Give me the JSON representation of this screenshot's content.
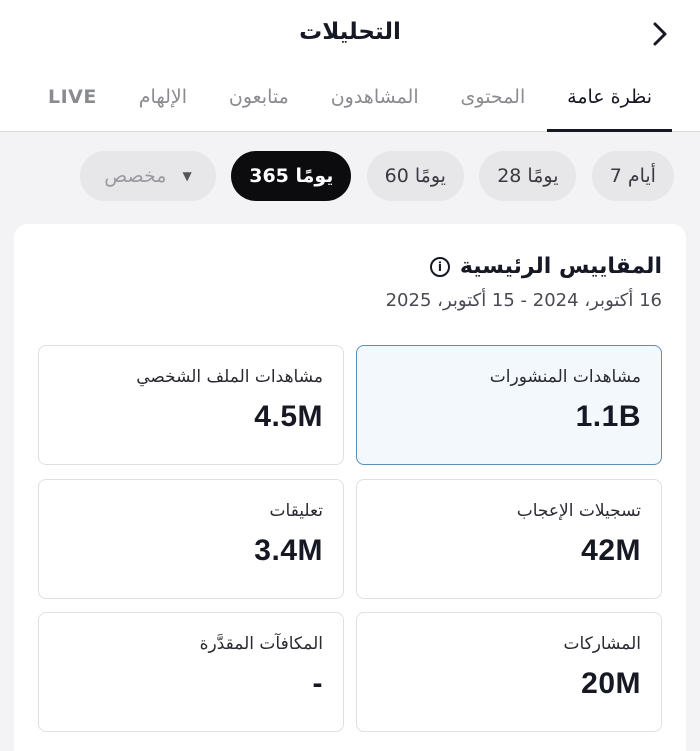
{
  "header": {
    "title": "التحليلات"
  },
  "tabs": [
    {
      "label": "نظرة عامة",
      "active": true
    },
    {
      "label": "المحتوى",
      "active": false
    },
    {
      "label": "المشاهدون",
      "active": false
    },
    {
      "label": "متابعون",
      "active": false
    },
    {
      "label": "الإلهام",
      "active": false
    },
    {
      "label": "LIVE",
      "active": false
    }
  ],
  "date_chips": [
    {
      "label": "7 أيام",
      "active": false
    },
    {
      "label": "28 يومًا",
      "active": false
    },
    {
      "label": "60 يومًا",
      "active": false
    },
    {
      "label": "365 يومًا",
      "active": true
    },
    {
      "label": "مخصص",
      "active": false
    }
  ],
  "metrics_panel": {
    "title": "المقاييس الرئيسية",
    "date_range": "16 أكتوبر، 2024 - 15 أكتوبر، 2025",
    "cards": [
      {
        "label": "مشاهدات المنشورات",
        "value": "1.1B",
        "selected": true
      },
      {
        "label": "مشاهدات الملف الشخصي",
        "value": "4.5M",
        "selected": false
      },
      {
        "label": "تسجيلات الإعجاب",
        "value": "42M",
        "selected": false
      },
      {
        "label": "تعليقات",
        "value": "3.4M",
        "selected": false
      },
      {
        "label": "المشاركات",
        "value": "20M",
        "selected": false
      },
      {
        "label": "المكافآت المقدَّرة",
        "value": "-",
        "selected": false
      }
    ]
  },
  "colors": {
    "accent_selected_border": "#5c8fb6",
    "active_chip": "#0c0c0e"
  },
  "icons": {
    "back": "chevron-right-icon",
    "info": "info-icon",
    "dropdown": "caret-down-icon"
  }
}
